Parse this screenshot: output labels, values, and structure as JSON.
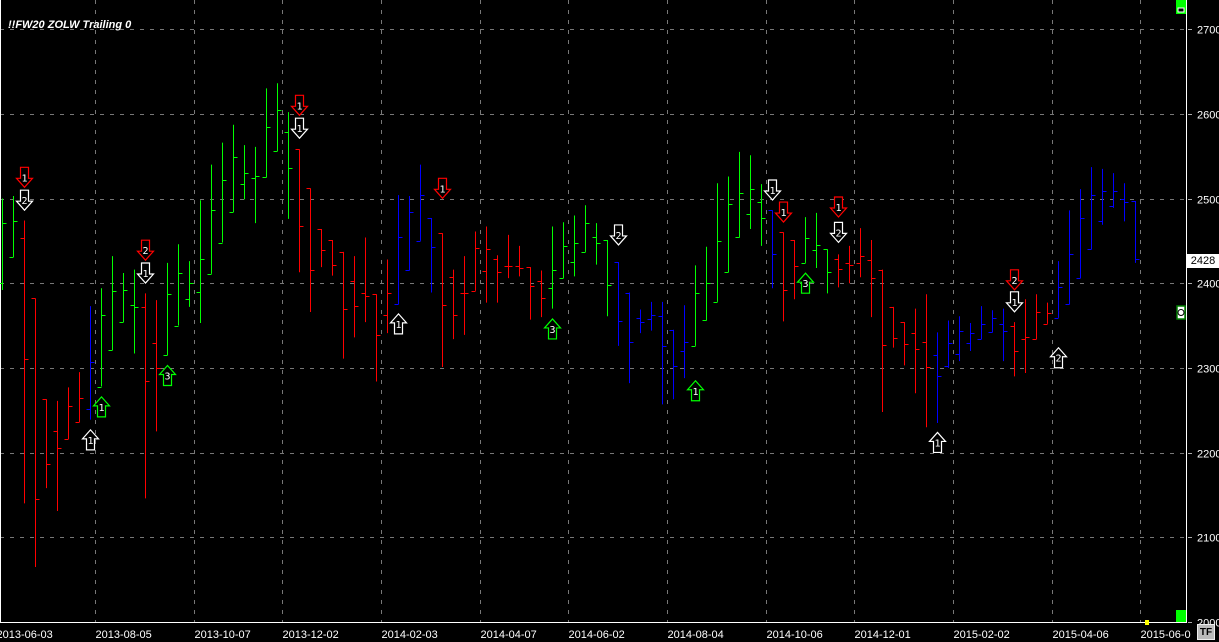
{
  "chart_data": {
    "type": "ohlc-bar",
    "title": "!!FW20 ZOLW Trailing 0",
    "ylim": [
      2000,
      2734
    ],
    "grid": true,
    "yticks": [
      "2000",
      "2100",
      "2200",
      "2300",
      "2400",
      "2500",
      "2600",
      "2700"
    ],
    "ytick_values": [
      2000,
      2100,
      2200,
      2300,
      2400,
      2500,
      2600,
      2700
    ],
    "xticks": [
      {
        "label": "2013-06-03",
        "bar": 0
      },
      {
        "label": "2013-08-05",
        "bar": 9
      },
      {
        "label": "2013-10-07",
        "bar": 18
      },
      {
        "label": "2013-12-02",
        "bar": 26
      },
      {
        "label": "2014-02-03",
        "bar": 35
      },
      {
        "label": "2014-04-07",
        "bar": 44
      },
      {
        "label": "2014-06-02",
        "bar": 52
      },
      {
        "label": "2014-08-04",
        "bar": 61
      },
      {
        "label": "2014-10-06",
        "bar": 70
      },
      {
        "label": "2014-12-01",
        "bar": 78
      },
      {
        "label": "2015-02-02",
        "bar": 87
      },
      {
        "label": "2015-04-06",
        "bar": 96
      },
      {
        "label": "2015-06-0",
        "bar": 104
      }
    ],
    "last_price": "2428",
    "colors": {
      "g": "#00ff00",
      "r": "#ff0000",
      "b": "#0000ff",
      "white": "#ffffff",
      "grid": "#808080"
    },
    "bars_format": [
      "open",
      "high",
      "low",
      "close",
      "color"
    ],
    "bars": [
      [
        2400,
        2500,
        2392,
        2471,
        "g"
      ],
      [
        2431,
        2503,
        2431,
        2474,
        "g"
      ],
      [
        2453,
        2474,
        2140,
        2311,
        "r"
      ],
      [
        2382,
        2382,
        2065,
        2145,
        "r"
      ],
      [
        2263,
        2263,
        2158,
        2187,
        "r"
      ],
      [
        2225,
        2261,
        2131,
        2206,
        "r"
      ],
      [
        2216,
        2277,
        2216,
        2255,
        "r"
      ],
      [
        2236,
        2295,
        2236,
        2265,
        "r"
      ],
      [
        2251,
        2373,
        2239,
        2307,
        "b"
      ],
      [
        2278,
        2394,
        2278,
        2362,
        "g"
      ],
      [
        2321,
        2432,
        2321,
        2391,
        "g"
      ],
      [
        2354,
        2412,
        2354,
        2392,
        "g"
      ],
      [
        2374,
        2416,
        2317,
        2372,
        "g"
      ],
      [
        2372,
        2388,
        2146,
        2285,
        "r"
      ],
      [
        2329,
        2380,
        2225,
        2300,
        "r"
      ],
      [
        2315,
        2424,
        2315,
        2387,
        "g"
      ],
      [
        2350,
        2446,
        2350,
        2412,
        "g"
      ],
      [
        2381,
        2426,
        2372,
        2400,
        "g"
      ],
      [
        2390,
        2498,
        2353,
        2429,
        "g"
      ],
      [
        2411,
        2540,
        2411,
        2486,
        "g"
      ],
      [
        2448,
        2566,
        2448,
        2522,
        "g"
      ],
      [
        2484,
        2587,
        2484,
        2549,
        "g"
      ],
      [
        2517,
        2563,
        2499,
        2530,
        "g"
      ],
      [
        2524,
        2561,
        2471,
        2527,
        "g"
      ],
      [
        2525,
        2630,
        2525,
        2585,
        "g"
      ],
      [
        2556,
        2636,
        2556,
        2604,
        "g"
      ],
      [
        2579,
        2602,
        2476,
        2536,
        "g"
      ],
      [
        2558,
        2558,
        2413,
        2467,
        "r"
      ],
      [
        2512,
        2512,
        2366,
        2415,
        "r"
      ],
      [
        2464,
        2464,
        2419,
        2439,
        "r"
      ],
      [
        2451,
        2451,
        2409,
        2422,
        "r"
      ],
      [
        2437,
        2437,
        2311,
        2369,
        "r"
      ],
      [
        2403,
        2432,
        2336,
        2373,
        "r"
      ],
      [
        2388,
        2454,
        2354,
        2385,
        "r"
      ],
      [
        2387,
        2387,
        2284,
        2339,
        "r"
      ],
      [
        2363,
        2428,
        2341,
        2388,
        "r"
      ],
      [
        2375,
        2504,
        2375,
        2455,
        "b"
      ],
      [
        2415,
        2503,
        2415,
        2484,
        "b"
      ],
      [
        2450,
        2540,
        2450,
        2504,
        "b"
      ],
      [
        2477,
        2477,
        2389,
        2443,
        "b"
      ],
      [
        2459,
        2459,
        2301,
        2374,
        "r"
      ],
      [
        2407,
        2416,
        2334,
        2362,
        "r"
      ],
      [
        2389,
        2432,
        2339,
        2389,
        "r"
      ],
      [
        2391,
        2461,
        2391,
        2441,
        "r"
      ],
      [
        2414,
        2467,
        2377,
        2440,
        "r"
      ],
      [
        2428,
        2433,
        2377,
        2413,
        "r"
      ],
      [
        2420,
        2457,
        2406,
        2420,
        "r"
      ],
      [
        2420,
        2444,
        2408,
        2418,
        "r"
      ],
      [
        2419,
        2419,
        2357,
        2397,
        "r"
      ],
      [
        2403,
        2415,
        2360,
        2383,
        "r"
      ],
      [
        2394,
        2467,
        2370,
        2416,
        "g"
      ],
      [
        2406,
        2472,
        2406,
        2444,
        "g"
      ],
      [
        2425,
        2480,
        2408,
        2448,
        "g"
      ],
      [
        2437,
        2492,
        2437,
        2471,
        "g"
      ],
      [
        2454,
        2471,
        2422,
        2448,
        "g"
      ],
      [
        2451,
        2451,
        2361,
        2398,
        "g"
      ],
      [
        2425,
        2425,
        2326,
        2355,
        "b"
      ],
      [
        2389,
        2389,
        2282,
        2330,
        "b"
      ],
      [
        2359,
        2369,
        2341,
        2354,
        "b"
      ],
      [
        2358,
        2378,
        2344,
        2363,
        "b"
      ],
      [
        2361,
        2378,
        2257,
        2326,
        "b"
      ],
      [
        2345,
        2345,
        2263,
        2302,
        "b"
      ],
      [
        2320,
        2374,
        2288,
        2330,
        "b"
      ],
      [
        2326,
        2421,
        2326,
        2388,
        "g"
      ],
      [
        2356,
        2443,
        2356,
        2400,
        "g"
      ],
      [
        2378,
        2518,
        2378,
        2450,
        "g"
      ],
      [
        2413,
        2526,
        2413,
        2493,
        "g"
      ],
      [
        2454,
        2555,
        2454,
        2507,
        "g"
      ],
      [
        2482,
        2551,
        2464,
        2511,
        "g"
      ],
      [
        2496,
        2517,
        2444,
        2477,
        "g"
      ],
      [
        2486,
        2486,
        2394,
        2434,
        "b"
      ],
      [
        2460,
        2460,
        2355,
        2392,
        "r"
      ],
      [
        2451,
        2451,
        2381,
        2420,
        "r"
      ],
      [
        2424,
        2478,
        2424,
        2453,
        "g"
      ],
      [
        2439,
        2483,
        2418,
        2445,
        "g"
      ],
      [
        2440,
        2440,
        2388,
        2413,
        "g"
      ],
      [
        2428,
        2434,
        2395,
        2417,
        "r"
      ],
      [
        2424,
        2444,
        2400,
        2422,
        "r"
      ],
      [
        2424,
        2465,
        2407,
        2432,
        "r"
      ],
      [
        2427,
        2451,
        2360,
        2406,
        "r"
      ],
      [
        2416,
        2416,
        2248,
        2327,
        "r"
      ],
      [
        2372,
        2372,
        2324,
        2335,
        "r"
      ],
      [
        2354,
        2354,
        2303,
        2328,
        "r"
      ],
      [
        2341,
        2370,
        2270,
        2322,
        "r"
      ],
      [
        2331,
        2387,
        2230,
        2301,
        "r"
      ],
      [
        2315,
        2342,
        2235,
        2291,
        "b"
      ],
      [
        2302,
        2356,
        2300,
        2329,
        "b"
      ],
      [
        2316,
        2361,
        2308,
        2343,
        "b"
      ],
      [
        2329,
        2353,
        2320,
        2341,
        "b"
      ],
      [
        2334,
        2373,
        2334,
        2352,
        "b"
      ],
      [
        2342,
        2368,
        2342,
        2359,
        "b"
      ],
      [
        2352,
        2370,
        2308,
        2344,
        "b"
      ],
      [
        2349,
        2354,
        2290,
        2320,
        "r"
      ],
      [
        2334,
        2381,
        2294,
        2337,
        "r"
      ],
      [
        2334,
        2387,
        2334,
        2366,
        "r"
      ],
      [
        2352,
        2377,
        2352,
        2365,
        "r"
      ],
      [
        2359,
        2426,
        2359,
        2395,
        "b"
      ],
      [
        2375,
        2486,
        2375,
        2435,
        "b"
      ],
      [
        2406,
        2511,
        2406,
        2477,
        "b"
      ],
      [
        2440,
        2537,
        2440,
        2504,
        "b"
      ],
      [
        2473,
        2535,
        2469,
        2509,
        "b"
      ],
      [
        2491,
        2530,
        2489,
        2509,
        "b"
      ],
      [
        2499,
        2518,
        2473,
        2496,
        "b"
      ],
      [
        2497,
        2497,
        2424,
        2428,
        "b"
      ]
    ],
    "signals": [
      {
        "bar": 2,
        "price": 2525,
        "dir": "down",
        "color": "r",
        "label": "1"
      },
      {
        "bar": 2,
        "price": 2498,
        "dir": "down",
        "color": "white",
        "label": "2"
      },
      {
        "bar": 8,
        "price": 2215,
        "dir": "up",
        "color": "white",
        "label": "1"
      },
      {
        "bar": 9,
        "price": 2254,
        "dir": "up",
        "color": "g",
        "label": "1"
      },
      {
        "bar": 13,
        "price": 2439,
        "dir": "down",
        "color": "r",
        "label": "2"
      },
      {
        "bar": 13,
        "price": 2412,
        "dir": "down",
        "color": "white",
        "label": "1"
      },
      {
        "bar": 15,
        "price": 2291,
        "dir": "up",
        "color": "g",
        "label": "3"
      },
      {
        "bar": 27,
        "price": 2610,
        "dir": "down",
        "color": "r",
        "label": "1"
      },
      {
        "bar": 27,
        "price": 2583,
        "dir": "down",
        "color": "white",
        "label": "1"
      },
      {
        "bar": 36,
        "price": 2352,
        "dir": "up",
        "color": "white",
        "label": "1"
      },
      {
        "bar": 40,
        "price": 2512,
        "dir": "down",
        "color": "r",
        "label": "1"
      },
      {
        "bar": 50,
        "price": 2346,
        "dir": "up",
        "color": "g",
        "label": "3"
      },
      {
        "bar": 56,
        "price": 2457,
        "dir": "down",
        "color": "white",
        "label": "2"
      },
      {
        "bar": 63,
        "price": 2273,
        "dir": "up",
        "color": "g",
        "label": "1"
      },
      {
        "bar": 70,
        "price": 2510,
        "dir": "down",
        "color": "white",
        "label": "1"
      },
      {
        "bar": 71,
        "price": 2484,
        "dir": "down",
        "color": "r",
        "label": "1"
      },
      {
        "bar": 73,
        "price": 2400,
        "dir": "up",
        "color": "g",
        "label": "3"
      },
      {
        "bar": 76,
        "price": 2490,
        "dir": "down",
        "color": "r",
        "label": "1"
      },
      {
        "bar": 76,
        "price": 2460,
        "dir": "down",
        "color": "white",
        "label": "2"
      },
      {
        "bar": 85,
        "price": 2212,
        "dir": "up",
        "color": "white",
        "label": "1"
      },
      {
        "bar": 92,
        "price": 2404,
        "dir": "down",
        "color": "r",
        "label": "2"
      },
      {
        "bar": 92,
        "price": 2378,
        "dir": "down",
        "color": "white",
        "label": "1"
      },
      {
        "bar": 96,
        "price": 2312,
        "dir": "up",
        "color": "white",
        "label": "2"
      }
    ]
  },
  "ui": {
    "tf_button": "TF"
  }
}
